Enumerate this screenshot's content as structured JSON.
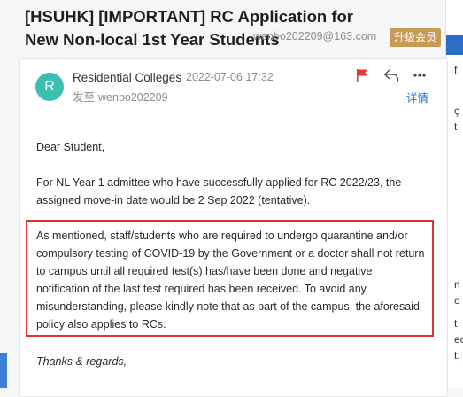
{
  "email": {
    "subject": "[HSUHK] [IMPORTANT] RC Application for New Non-local 1st Year Students",
    "sender_email": "wenbo202209@163.com",
    "vip_badge": "升级会员",
    "avatar_letter": "R",
    "from_name": "Residential Colleges",
    "date": "2022-07-06 17:32",
    "to_label": "发至",
    "to_name": "wenbo202209",
    "details_label": "详情",
    "body": {
      "greeting": "Dear Student,",
      "paragraph_1": "For NL Year 1 admittee who have successfully applied for RC 2022/23, the assigned move-in date would be 2 Sep 2022 (tentative).",
      "paragraph_2": "As mentioned, staff/students who are required to undergo quarantine and/or compulsory testing of COVID-19 by the Government or a doctor shall not return to campus until all required test(s) has/have been done and negative notification of the last test required has been received. To avoid any misunderstanding, please kindly note that as part of the campus, the aforesaid policy also applies to RCs.",
      "closing": "Thanks & regards,"
    }
  },
  "right_strip": {
    "chars": [
      "f",
      "ç",
      "t",
      "n",
      "o",
      "t",
      "ec",
      "t,"
    ]
  },
  "colors": {
    "accent_blue": "#2f74d0",
    "avatar_teal": "#3cbfb0",
    "vip_gold": "#c99a56",
    "highlight_red": "#d9362f",
    "flag_red": "#e53935"
  },
  "icons": {
    "flag": "flag-icon",
    "reply": "reply-icon",
    "more": "more-icon"
  }
}
